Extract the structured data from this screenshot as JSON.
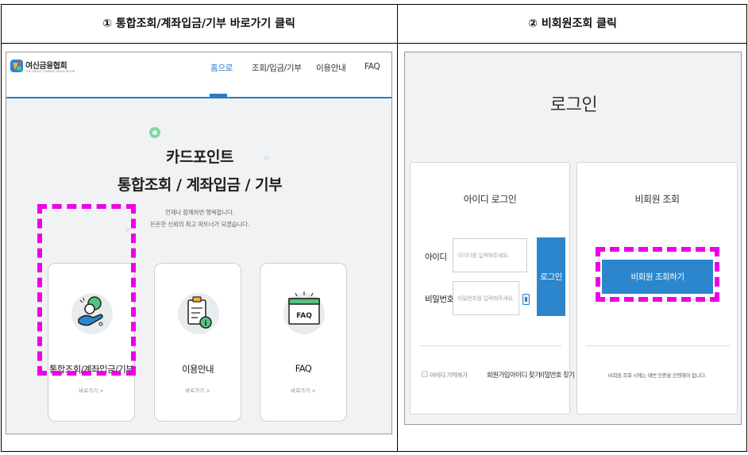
{
  "captions": {
    "left": "① 통합조회/계좌입금/기부 바로가기 클릭",
    "right": "② 비회원조회 클릭"
  },
  "left_panel": {
    "logo": {
      "title": "여신금융협회",
      "subtitle": "THE CREDIT FINANCE ASSOCIATION",
      "icon": "credit-finance-logo-icon"
    },
    "nav": [
      {
        "label": "홈으로",
        "active": true
      },
      {
        "label": "조회/입금/기부",
        "active": false
      },
      {
        "label": "이용안내",
        "active": false
      },
      {
        "label": "FAQ",
        "active": false
      }
    ],
    "hero": {
      "line1": "카드포인트",
      "line2": "통합조회 / 계좌입금 / 기부",
      "sub1": "언제나 함께하면 행복합니다.",
      "sub2": "든든한 신뢰의 최고 파트너가 되겠습니다."
    },
    "cards": [
      {
        "title": "통합조회/계좌입금/기부",
        "link": "바로가기 >",
        "icon": "hand-coin-icon",
        "highlighted": true
      },
      {
        "title": "이용안내",
        "link": "바로가기 >",
        "icon": "clipboard-info-icon",
        "highlighted": false
      },
      {
        "title": "FAQ",
        "link": "바로가기 >",
        "icon": "faq-window-icon",
        "highlighted": false
      }
    ]
  },
  "right_panel": {
    "title": "로그인",
    "id_login": {
      "title": "아이디 로그인",
      "id_label": "아이디",
      "id_placeholder": "아이디를 입력해주세요.",
      "pw_label": "비밀번호",
      "pw_placeholder": "비밀번호를 입력해주세요.",
      "login_button": "로그인",
      "remember": "아이디 기억하기",
      "links": [
        "회원가입",
        "아이디 찾기",
        "비밀번호 찾기"
      ]
    },
    "guest": {
      "title": "비회원 조회",
      "button": "비회원 조회하기",
      "note": "비회원 조회 시에는 매번 인증을 진행해야 합니다.",
      "highlighted": true
    }
  },
  "colors": {
    "accent": "#2b86cd",
    "highlight": "#ee00e6",
    "deco_green": "#7fd7a3"
  }
}
